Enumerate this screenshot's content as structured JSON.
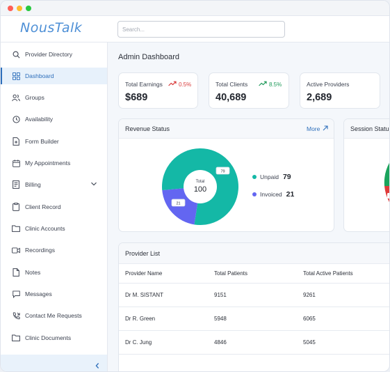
{
  "app": {
    "logo": "NousTalk"
  },
  "search": {
    "placeholder": "Search..."
  },
  "sidebar": {
    "items": [
      {
        "label": "Provider Directory",
        "icon": "search-icon"
      },
      {
        "label": "Dashboard",
        "icon": "grid-icon",
        "active": true
      },
      {
        "label": "Groups",
        "icon": "users-icon"
      },
      {
        "label": "Availability",
        "icon": "clock-icon"
      },
      {
        "label": "Form Builder",
        "icon": "file-plus-icon"
      },
      {
        "label": "My Appointments",
        "icon": "calendar-icon"
      },
      {
        "label": "Billing",
        "icon": "receipt-icon"
      },
      {
        "label": "Client Record",
        "icon": "clipboard-icon"
      },
      {
        "label": "Clinic Accounts",
        "icon": "folder-icon"
      },
      {
        "label": "Recordings",
        "icon": "video-icon"
      },
      {
        "label": "Notes",
        "icon": "file-icon"
      },
      {
        "label": "Messages",
        "icon": "message-icon"
      },
      {
        "label": "Contact Me Requests",
        "icon": "phone-icon"
      },
      {
        "label": "Clinic Documents",
        "icon": "folder-icon"
      }
    ]
  },
  "main": {
    "title": "Admin Dashboard",
    "stats": [
      {
        "label": "Total Earnings",
        "value": "$689",
        "trend": "0.5%",
        "trend_color": "#d93b3b"
      },
      {
        "label": "Total Clients",
        "value": "40,689",
        "trend": "8.5%",
        "trend_color": "#1f9a5a"
      },
      {
        "label": "Active Providers",
        "value": "2,689"
      }
    ],
    "revenue": {
      "title": "Revenue Status",
      "more": "More",
      "center_label": "Total",
      "center_value": "100",
      "legend": [
        {
          "label": "Unpaid",
          "value": "79",
          "color": "#14b8a6"
        },
        {
          "label": "Invoiced",
          "value": "21",
          "color": "#6366f1"
        }
      ]
    },
    "session": {
      "title": "Session Status"
    },
    "providers": {
      "title": "Provider List",
      "columns": [
        "Provider Name",
        "Total Patients",
        "Total Active Patients"
      ],
      "rows": [
        [
          "Dr M. SISTANT",
          "9151",
          "9261"
        ],
        [
          "Dr R. Green",
          "5948",
          "6065"
        ],
        [
          "Dr C. Jung",
          "4846",
          "5045"
        ]
      ]
    }
  }
}
